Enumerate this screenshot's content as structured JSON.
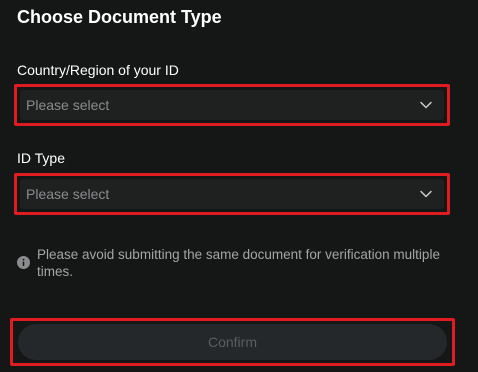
{
  "page": {
    "title": "Choose Document Type"
  },
  "country_field": {
    "label": "Country/Region of your ID",
    "placeholder": "Please select",
    "icon": "chevron-down-icon"
  },
  "id_type_field": {
    "label": "ID Type",
    "placeholder": "Please select",
    "icon": "chevron-down-icon"
  },
  "notice": {
    "icon": "info-icon",
    "text": "Please avoid submitting the same document for verification multiple times."
  },
  "confirm": {
    "label": "Confirm",
    "state": "disabled"
  },
  "colors": {
    "background": "#151616",
    "field_background": "#1f2020",
    "highlight_outline": "#e01b22",
    "placeholder_text": "#8a8c8e",
    "notice_text": "#a3a5a7",
    "button_disabled_bg": "#25282b",
    "button_disabled_text": "#5a5d61"
  }
}
